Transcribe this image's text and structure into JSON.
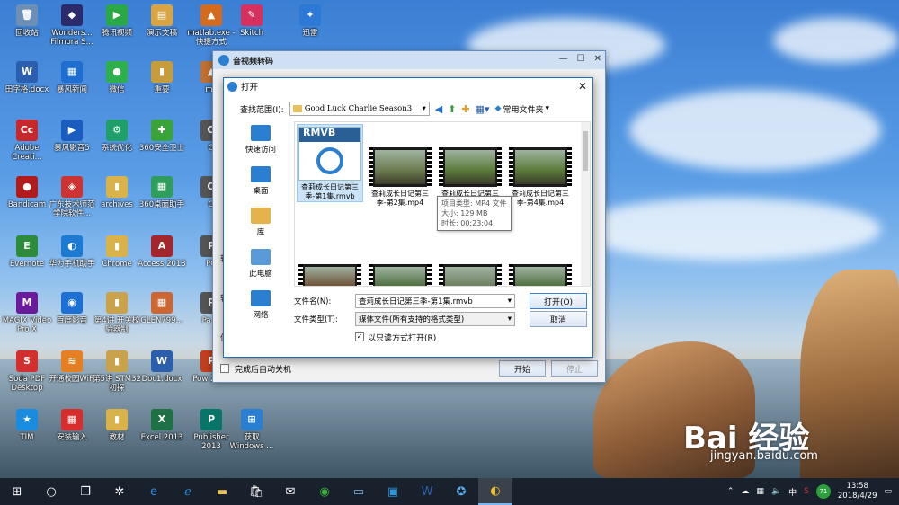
{
  "desktop_icons": [
    {
      "label": "回收站",
      "color": "#6d8fb5",
      "glyph": "🗑"
    },
    {
      "label": "Wonders... Filmora S...",
      "color": "#2b2b6b",
      "glyph": "◆"
    },
    {
      "label": "腾讯视频",
      "color": "#2aa845",
      "glyph": "▶"
    },
    {
      "label": "演示文稿",
      "color": "#d9a441",
      "glyph": "▤"
    },
    {
      "label": "matlab.exe - 快捷方式",
      "color": "#d46a1e",
      "glyph": "▲"
    },
    {
      "label": "Skitch",
      "color": "#d6305f",
      "glyph": "✎"
    },
    {
      "label": "迅雷",
      "color": "#2c7ad6",
      "glyph": "✦"
    },
    {
      "label": "田字格.docx",
      "color": "#2b5fae",
      "glyph": "W"
    },
    {
      "label": "暴风新闻",
      "color": "#1e6fcf",
      "glyph": "▦"
    },
    {
      "label": "微信",
      "color": "#2db04b",
      "glyph": "●"
    },
    {
      "label": "重要",
      "color": "#c89b3c",
      "glyph": "▮"
    },
    {
      "label": "ma",
      "color": "#c07030",
      "glyph": "▲"
    },
    {
      "label": "Adobe Creati...",
      "color": "#c8282b",
      "glyph": "Cc"
    },
    {
      "label": "暴风影音5",
      "color": "#1b5dbf",
      "glyph": "▶"
    },
    {
      "label": "系统优化",
      "color": "#1fa06b",
      "glyph": "⚙"
    },
    {
      "label": "360安全卫士",
      "color": "#3aa33a",
      "glyph": "✚"
    },
    {
      "label": "O",
      "color": "#555",
      "glyph": "O"
    },
    {
      "label": "Bandicam",
      "color": "#b01b1b",
      "glyph": "●"
    },
    {
      "label": "广东技术师范学院软件...",
      "color": "#c33",
      "glyph": "◈"
    },
    {
      "label": "archives",
      "color": "#d9b24a",
      "glyph": "▮"
    },
    {
      "label": "360桌面助手",
      "color": "#2f9e5a",
      "glyph": "▦"
    },
    {
      "label": "O",
      "color": "#555",
      "glyph": "O"
    },
    {
      "label": "Evernote",
      "color": "#2d8c3a",
      "glyph": "E"
    },
    {
      "label": "华为手机助手",
      "color": "#1c7bd0",
      "glyph": "◐"
    },
    {
      "label": "Chrome",
      "color": "#d9b24a",
      "glyph": "▮"
    },
    {
      "label": "Access 2013",
      "color": "#a4262c",
      "glyph": "A"
    },
    {
      "label": "PO",
      "color": "#555",
      "glyph": "P"
    },
    {
      "label": "MAGIX Video Pro X",
      "color": "#6a1b9a",
      "glyph": "M"
    },
    {
      "label": "百度影音",
      "color": "#1c6fd3",
      "glyph": "◉"
    },
    {
      "label": "第4讲 开关校验器制",
      "color": "#c9a24a",
      "glyph": "▮"
    },
    {
      "label": "GLEN799...",
      "color": "#c63",
      "glyph": "▦"
    },
    {
      "label": "Pa ...",
      "color": "#555",
      "glyph": "P"
    },
    {
      "label": "Soda PDF Desktop",
      "color": "#d32f2f",
      "glyph": "S"
    },
    {
      "label": "开通校园WiFi",
      "color": "#e67e22",
      "glyph": "≋"
    },
    {
      "label": "第5讲 STM32初探",
      "color": "#c9a24a",
      "glyph": "▮"
    },
    {
      "label": "Doc1.docx",
      "color": "#2b5fae",
      "glyph": "W"
    },
    {
      "label": "Pow 2013",
      "color": "#c43e1c",
      "glyph": "P"
    },
    {
      "label": "TIM",
      "color": "#1a8ce0",
      "glyph": "★"
    },
    {
      "label": "安装输入",
      "color": "#d62d2d",
      "glyph": "▦"
    },
    {
      "label": "教材",
      "color": "#d9b24a",
      "glyph": "▮"
    },
    {
      "label": "Excel 2013",
      "color": "#1e7145",
      "glyph": "X"
    },
    {
      "label": "Publisher 2013",
      "color": "#077568",
      "glyph": "P"
    },
    {
      "label": "获取 Windows ...",
      "color": "#2a7fd0",
      "glyph": "⊞"
    }
  ],
  "app": {
    "title": "音视频转码",
    "bottom_checkbox": "完成后自动关机",
    "start_btn": "开始",
    "stop_btn": "停止",
    "left_edge_labels": [
      "转",
      "转",
      "保"
    ]
  },
  "dialog": {
    "title": "打开",
    "lookin_label": "查找范围(I):",
    "lookin_value": "Good Luck Charlie Season3",
    "common_folders": "常用文件夹",
    "places": [
      {
        "label": "快速访问",
        "color": "#2a7fd0"
      },
      {
        "label": "桌面",
        "color": "#2a7fd0"
      },
      {
        "label": "库",
        "color": "#e6b24a"
      },
      {
        "label": "此电脑",
        "color": "#5a9ad8"
      },
      {
        "label": "网络",
        "color": "#2a7fd0"
      }
    ],
    "files": [
      {
        "name": "查莉成长日记第三季-第1集.rmvb",
        "type": "rmvb"
      },
      {
        "name": "查莉成长日记第三季-第2集.mp4",
        "type": "video",
        "scene": "#6b7a4e"
      },
      {
        "name": "查莉成长日记第三季-第3集.mp4",
        "type": "video",
        "scene": "#5a7a3a"
      },
      {
        "name": "查莉成长日记第三季-第4集.mp4",
        "type": "video",
        "scene": "#5a7a3a"
      },
      {
        "name": "",
        "type": "video",
        "scene": "#6a4a30"
      },
      {
        "name": "",
        "type": "video",
        "scene": "#4a6a3a"
      },
      {
        "name": "",
        "type": "video",
        "scene": "#6a7a5a"
      },
      {
        "name": "",
        "type": "video",
        "scene": "#4a6a3a"
      }
    ],
    "rmvb_badge": "RMVB",
    "tooltip": [
      "项目类型: MP4 文件",
      "大小: 129 MB",
      "时长: 00:23:04"
    ],
    "filename_label": "文件名(N):",
    "filename_value": "查莉成长日记第三季-第1集.rmvb",
    "filetype_label": "文件类型(T):",
    "filetype_value": "媒体文件(所有支持的格式类型)",
    "readonly_label": "以只读方式打开(R)",
    "open_btn": "打开(O)",
    "cancel_btn": "取消"
  },
  "taskbar": {
    "clock_time": "13:58",
    "clock_date": "2018/4/29",
    "lang": "中",
    "badge": "71"
  },
  "watermark": {
    "brand": "Bai 经验",
    "url": "jingyan.baidu.com"
  }
}
